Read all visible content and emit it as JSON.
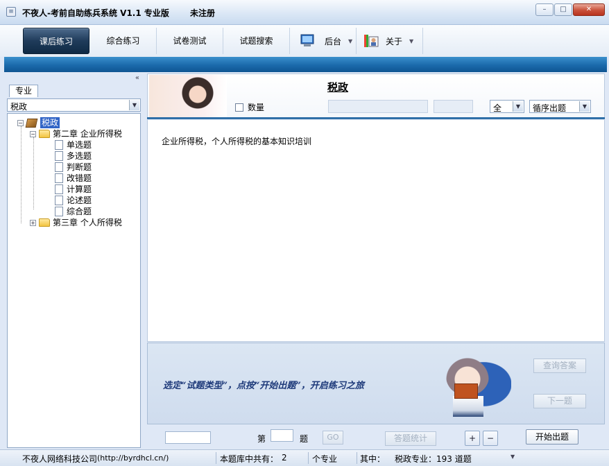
{
  "window": {
    "title": "不夜人-考前自助练兵系统 V1.1  专业版",
    "registration": "未注册",
    "minimize": "–",
    "maximize": "□",
    "close": "✕"
  },
  "toolbar": {
    "tabs": [
      {
        "label": "课后练习",
        "active": true
      },
      {
        "label": "综合练习"
      },
      {
        "label": "试卷测试"
      },
      {
        "label": "试题搜索"
      }
    ],
    "backend_label": "后台",
    "about_label": "关于"
  },
  "sidebar": {
    "collapse": "«",
    "tab_label": "专业",
    "major_select": "税政",
    "tree": {
      "root": "税政",
      "chapter2": "第二章  企业所得税",
      "items": [
        "单选题",
        "多选题",
        "判断题",
        "改错题",
        "计算题",
        "论述题",
        "综合题"
      ],
      "chapter3": "第三章  个人所得税"
    }
  },
  "header": {
    "subject": "税政",
    "quantity_label": "数量",
    "range_select": "全",
    "order_select": "循序出题"
  },
  "content": {
    "description": "企业所得税，个人所得税的基本知识培训"
  },
  "practice": {
    "slogan": "选定“试题类型”，点按“开始出题”，开启练习之旅",
    "check_answer": "查询答案",
    "next_question": "下一题"
  },
  "nav": {
    "prefix": "第",
    "suffix": "题",
    "go": "GO",
    "stats": "答题统计",
    "zoom_in": "+",
    "zoom_out": "−",
    "start": "开始出题"
  },
  "status": {
    "company": "不夜人网络科技公司",
    "url": "(http://byrdhcl.cn/)",
    "bank_label": "本题库中共有：",
    "count": "2",
    "unit": "个专业",
    "among": "其中：",
    "detail": "税政专业：193 道题"
  },
  "colors": {
    "band": "#1b6aab",
    "selection": "#3164c6",
    "slogan": "#1e3a7a"
  }
}
